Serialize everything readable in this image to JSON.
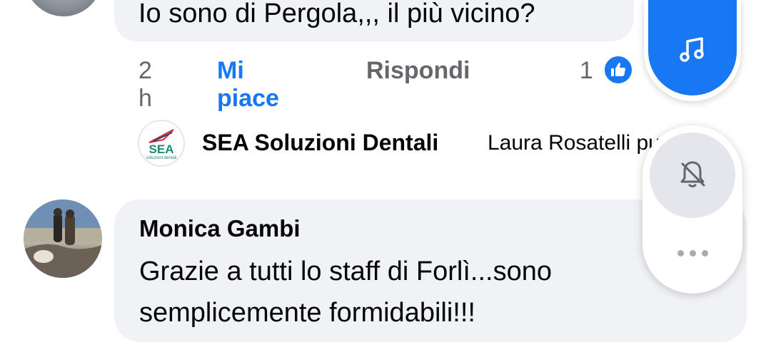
{
  "comment_top": {
    "text": "Io sono di Pergola,,, il più vicino?",
    "time": "2 h",
    "like_label": "Mi piace",
    "reply_label": "Rispondi",
    "reaction_count": "1"
  },
  "reply_preview": {
    "logo_text": "SEA",
    "logo_subtext": "soluzioni dentali",
    "author": "SEA Soluzioni Dentali",
    "text": "Laura Rosatelli può"
  },
  "comment_monica": {
    "author": "Monica Gambi",
    "line1": "Grazie a tutti lo staff di Forlì...sono",
    "line2": "semplicemente formidabili!!!"
  },
  "colors": {
    "accent": "#1877f2",
    "bubble": "#f0f2f5",
    "secondary_text": "#65676b"
  },
  "icons": [
    "music-note-icon",
    "bell-off-icon",
    "more-dots-icon",
    "thumbs-up-icon"
  ]
}
